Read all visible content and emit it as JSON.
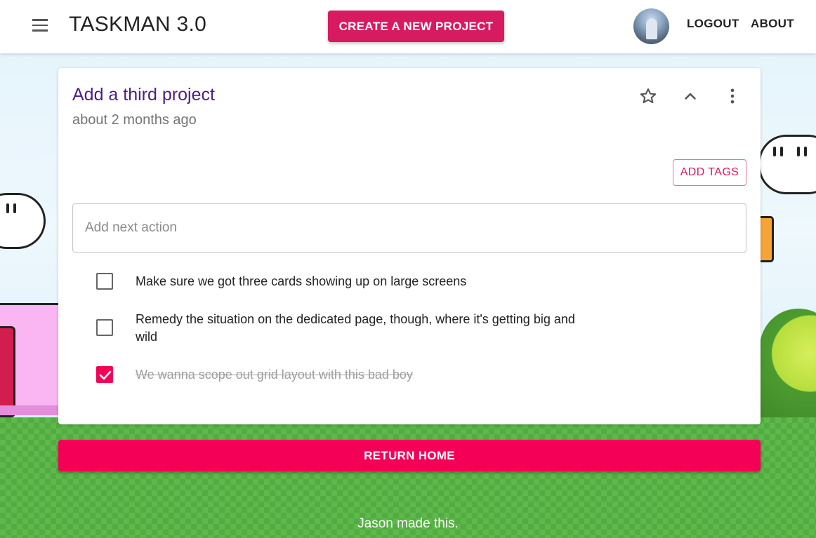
{
  "app_bar": {
    "title": "TASKMAN 3.0",
    "create_button_label": "CREATE A NEW PROJECT",
    "logout_label": "LOGOUT",
    "about_label": "ABOUT",
    "menu_icon": "hamburger-menu-icon",
    "avatar_icon": "user-avatar"
  },
  "project": {
    "title": "Add a third project",
    "subtitle": "about 2 months ago",
    "icons": [
      "star-outline-icon",
      "chevron-up-icon",
      "more-vertical-icon"
    ],
    "add_tags_label": "ADD TAGS",
    "next_action_placeholder": "Add next action",
    "next_action_value": "",
    "actions": [
      {
        "text": "Make sure we got three cards showing up on large screens",
        "done": false
      },
      {
        "text": "Remedy the situation on the dedicated page, though, where it's getting big and wild",
        "done": false
      },
      {
        "text": "We wanna scope out grid layout with this bad boy",
        "done": true
      }
    ]
  },
  "return_home_label": "RETURN HOME",
  "footer_text": "Jason made this.",
  "colors": {
    "primary": "#d81b60",
    "accent": "#f50057",
    "title": "#4b1f87"
  }
}
